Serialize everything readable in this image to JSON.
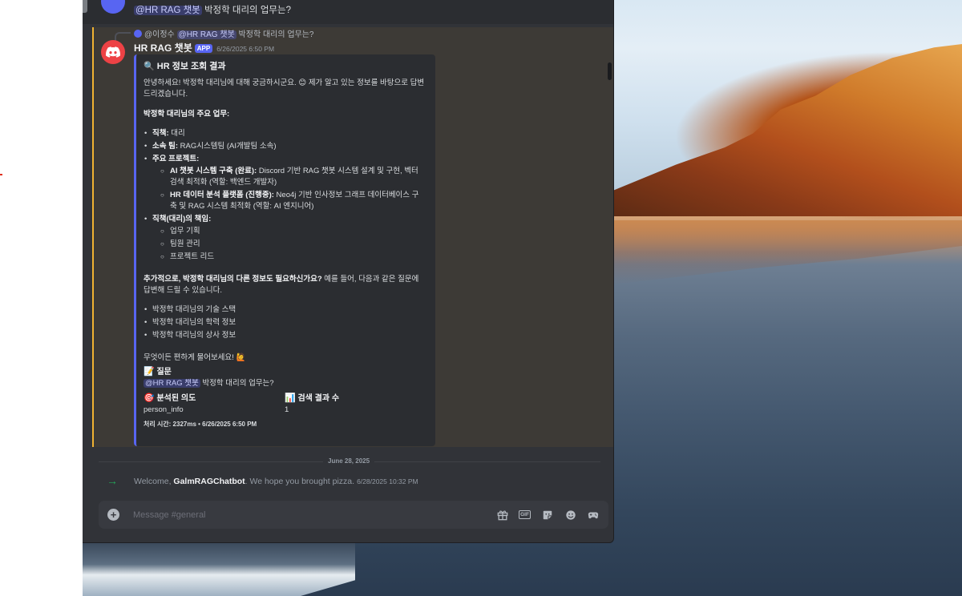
{
  "top_message": {
    "mention": "@HR RAG 챗봇",
    "text": " 박정학 대리의 업무는?"
  },
  "reply": {
    "author": "@이정수",
    "mention": "@HR RAG 챗봇",
    "text": " 박정학 대리의 업무는?"
  },
  "bot": {
    "name": "HR RAG 챗봇",
    "badge": "APP",
    "timestamp": "6/26/2025 6:50 PM"
  },
  "embed": {
    "title_icon": "🔍",
    "title": "HR 정보 조회 결과",
    "greeting": "안녕하세요! 박정학 대리님에 대해 궁금하시군요. 😊 제가 알고 있는 정보를 바탕으로 답변드리겠습니다.",
    "duties_heading": "박정학 대리님의 주요 업무:",
    "items": {
      "role_label": "직책:",
      "role_value": " 대리",
      "team_label": "소속 팀:",
      "team_value": " RAG시스템팀 (AI개발팀 소속)",
      "projects_label": "주요 프로젝트:",
      "project1_label": "AI 챗봇 시스템 구축 (완료):",
      "project1_value": " Discord 기반 RAG 챗봇 시스템 설계 및 구현, 벡터 검색 최적화 (역할: 백엔드 개발자)",
      "project2_label": "HR 데이터 분석 플랫폼 (진행중):",
      "project2_value": " Neo4j 기반 인사정보 그래프 데이터베이스 구축 및 RAG 시스템 최적화 (역할: AI 엔지니어)",
      "resp_label": "직책(대리)의 책임:",
      "resp1": "업무 기획",
      "resp2": "팀원 관리",
      "resp3": "프로젝트 리드"
    },
    "followup_bold": "추가적으로, 박정학 대리님의 다른 정보도 필요하신가요?",
    "followup_text": " 예를 들어, 다음과 같은 질문에 답변해 드릴 수 있습니다.",
    "suggestions": [
      "박정학 대리님의 기술 스택",
      "박정학 대리님의 학력 정보",
      "박정학 대리님의 상사 정보"
    ],
    "closing": "무엇이든 편하게 물어보세요! 🙋",
    "question_icon": "📝",
    "question_label": "질문",
    "question_mention": "@HR RAG 챗봇",
    "question_text": " 박정학 대리의 업무는?",
    "intent_icon": "🎯",
    "intent_label": "분석된 의도",
    "intent_value": "person_info",
    "count_icon": "📊",
    "count_label": "검색 결과 수",
    "count_value": "1",
    "footer": "처리 시간: 2327ms • 6/26/2025 6:50 PM"
  },
  "date_divider": "June 28, 2025",
  "welcome": {
    "prefix": "Welcome, ",
    "user": "GalmRAGChatbot",
    "suffix": ". We hope you brought pizza.",
    "timestamp": "6/28/2025 10:32 PM"
  },
  "input": {
    "placeholder": "Message #general"
  },
  "toolbar_icons": [
    "gift-icon",
    "gif-icon",
    "sticker-icon",
    "emoji-icon",
    "apps-icon"
  ],
  "colors": {
    "background": "#313338",
    "embed_bg": "#2b2d31",
    "embed_accent": "#5865f2",
    "bot_avatar": "#ed4245",
    "mention_text": "#c9cdfb",
    "welcome_arrow": "#23a559",
    "highlight": "#f0b232"
  }
}
